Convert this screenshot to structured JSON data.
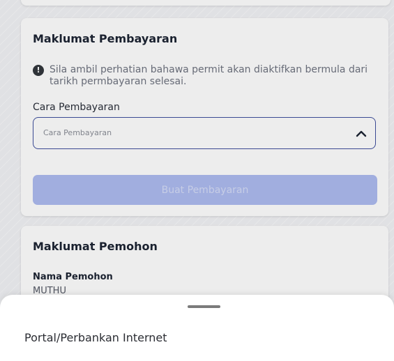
{
  "payment_card": {
    "title": "Maklumat Pembayaran",
    "notice": "Sila ambil perhatian bahawa permit akan diaktifkan bermula dari tarikh permbayaran selesai.",
    "notice_icon": "info-icon",
    "payment_method_label": "Cara Pembayaran",
    "payment_method_placeholder": "Cara Pembayaran",
    "dropdown_icon": "chevron-up-icon",
    "pay_button_label": "Buat Pembayaran"
  },
  "applicant_card": {
    "title": "Maklumat Pemohon",
    "name_label": "Nama Pemohon",
    "name_value": "MUTHU"
  },
  "bottom_sheet": {
    "options": [
      {
        "label": "Portal/Perbankan Internet"
      }
    ]
  },
  "colors": {
    "accent_border": "#3f4f9e",
    "button_disabled": "#aebcf0",
    "background": "#f2f3f6"
  }
}
